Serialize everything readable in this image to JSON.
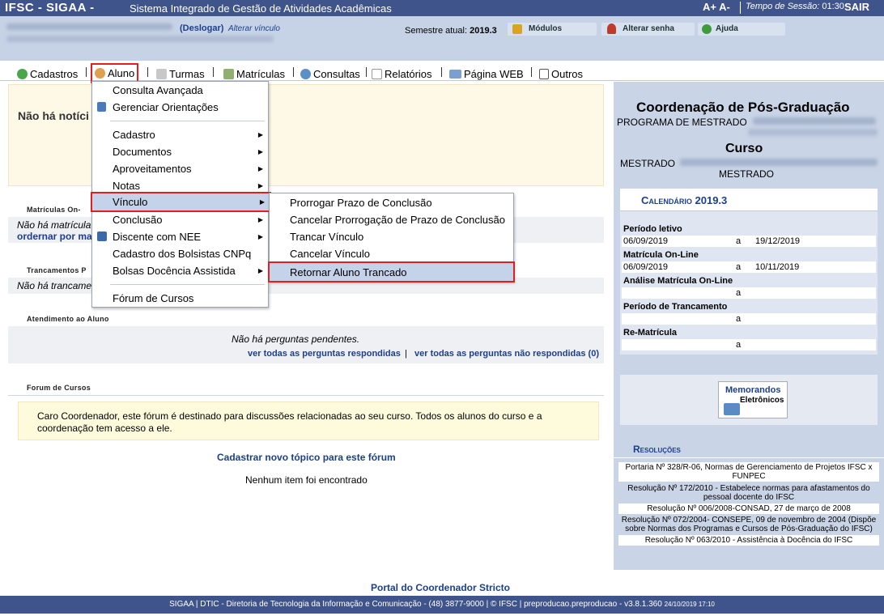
{
  "topbar": {
    "system": "IFSC - SIGAA -",
    "fullname": "Sistema Integrado de Gestão de Atividades Acadêmicas",
    "font_controls": "A+ A-",
    "session_label": "Tempo de Sessão:",
    "session_time": "01:30",
    "logout": "SAIR"
  },
  "userinfo": {
    "logout_link": "(Deslogar)",
    "change_link": "Alterar vínculo",
    "semester_label": "Semestre atual:",
    "semester_value": "2019.3",
    "modules": "Módulos",
    "change_password": "Alterar senha",
    "help": "Ajuda"
  },
  "menubar": {
    "items": [
      {
        "label": "Cadastros",
        "icon": "plus-circle-icon"
      },
      {
        "label": "Aluno",
        "icon": "student-icon"
      },
      {
        "label": "Turmas",
        "icon": "class-icon"
      },
      {
        "label": "Matrículas",
        "icon": "enroll-icon"
      },
      {
        "label": "Consultas",
        "icon": "search-icon"
      },
      {
        "label": "Relatórios",
        "icon": "report-icon"
      },
      {
        "label": "Página WEB",
        "icon": "web-icon"
      },
      {
        "label": "Outros",
        "icon": "phone-icon"
      }
    ]
  },
  "aluno_menu": {
    "items": [
      "Consulta Avançada",
      "Gerenciar Orientações",
      "Cadastro",
      "Documentos",
      "Aproveitamentos",
      "Notas",
      "Vínculo",
      "Conclusão",
      "Discente com NEE",
      "Cadastro dos Bolsistas CNPq",
      "Bolsas Docência Assistida",
      "Fórum de Cursos"
    ]
  },
  "vinculo_menu": {
    "items": [
      "Prorrogar Prazo de Conclusão",
      "Cancelar Prorrogação de Prazo de Conclusão",
      "Trancar Vínculo",
      "Cancelar Vínculo",
      "Retornar Aluno Trancado"
    ]
  },
  "main": {
    "no_news": "Não há notíci",
    "matriculas_head": "Matrículas On-",
    "matriculas_text": "Não há matrícula",
    "matriculas_link": "ordernar por ma",
    "trancamentos_head": "Trancamentos P",
    "trancamentos_text": "Não há trancame",
    "atendimento_head": "Atendimento ao Aluno",
    "no_questions": "Não há perguntas pendentes.",
    "answered_link": "ver todas as perguntas respondidas",
    "unanswered_link": "ver todas as perguntas não respondidas (0)",
    "forum_head": "Forum de Cursos",
    "forum_text": "Caro Coordenador, este fórum é destinado para discussões relacionadas ao seu curso. Todos os alunos do curso e a coordenação tem acesso a ele.",
    "new_topic": "Cadastrar novo tópico para este fórum",
    "no_items": "Nenhum item foi encontrado"
  },
  "right": {
    "coord_title": "Coordenação de Pós-Graduação",
    "program_label": "PROGRAMA DE MESTRADO",
    "course_title": "Curso",
    "course_label": "MESTRADO",
    "course_level": "MESTRADO",
    "calendar_title": "Calendário 2019.3",
    "cal": [
      {
        "label": "Período letivo",
        "start": "06/09/2019",
        "sep": "a",
        "end": "19/12/2019"
      },
      {
        "label": "Matrícula On-Line",
        "start": "06/09/2019",
        "sep": "a",
        "end": "10/11/2019"
      },
      {
        "label": "Análise Matrícula On-Line",
        "start": "",
        "sep": "a",
        "end": ""
      },
      {
        "label": "Período de Trancamento",
        "start": "",
        "sep": "a",
        "end": ""
      },
      {
        "label": "Re-Matrícula",
        "start": "",
        "sep": "a",
        "end": ""
      }
    ],
    "memo_line1": "Memorandos",
    "memo_line2": "Eletrônicos",
    "resolucoes_title": "Resoluções",
    "resolucoes": [
      "Portaria Nº 328/R-06, Normas de Gerenciamento de Projetos IFSC x FUNPEC",
      "Resolução Nº 172/2010 - Estabelece normas para afastamentos do pessoal docente do IFSC",
      "Resolução Nº 006/2008-CONSAD, 27 de março de 2008",
      "Resolução Nº 072/2004- CONSEPE, 09 de novembro de 2004 (Dispõe sobre Normas dos Programas e Cursos de Pós-Graduação do IFSC)",
      "Resolução Nº 063/2010 - Assistência à Docência do IFSC"
    ]
  },
  "footer": {
    "portal": "Portal do Coordenador Stricto",
    "text": "SIGAA | DTIC - Diretoria de Tecnologia da Informação e Comunicação - (48) 3877-9000 | © IFSC | preproducao.preproducao - v3.8.1.360",
    "date": "24/10/2019 17:10"
  }
}
